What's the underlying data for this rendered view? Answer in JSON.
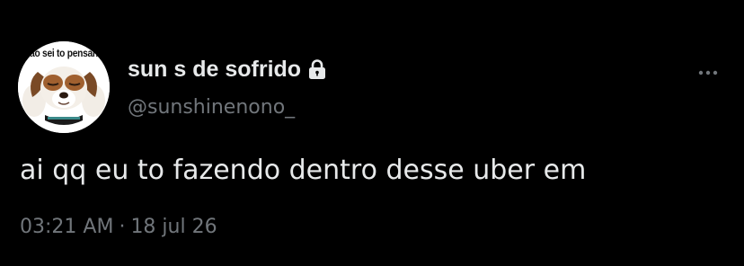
{
  "tweet": {
    "avatar_caption": "ão sei to pensan",
    "display_name": "sun s de sofrido",
    "handle": "@sunshinenono_",
    "text": "ai qq eu to fazendo dentro desse uber em",
    "time": "03:21 AM",
    "separator": "·",
    "date": "18 jul 26"
  },
  "icons": {
    "protected": "lock-icon",
    "more": "more-icon"
  },
  "colors": {
    "background": "#000000",
    "primary_text": "#e7e9ea",
    "secondary_text": "#71767b"
  }
}
